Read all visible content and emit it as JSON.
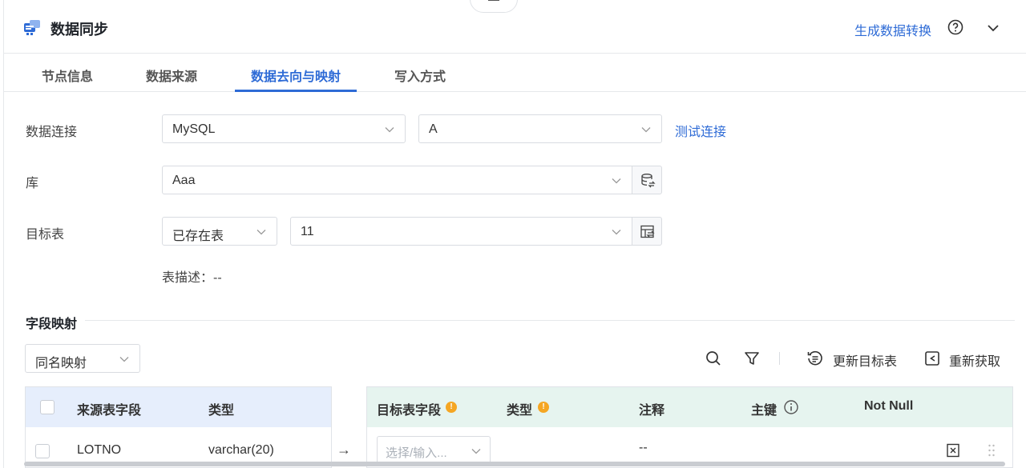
{
  "header": {
    "title": "数据同步",
    "generate_link": "生成数据转换"
  },
  "tabs": [
    {
      "label": "节点信息"
    },
    {
      "label": "数据来源"
    },
    {
      "label": "数据去向与映射",
      "active": true
    },
    {
      "label": "写入方式"
    }
  ],
  "form": {
    "connection_label": "数据连接",
    "connection_type": "MySQL",
    "connection_name": "A",
    "test_link": "测试连接",
    "db_label": "库",
    "db_value": "Aaa",
    "target_label": "目标表",
    "target_mode": "已存在表",
    "target_table": "11",
    "table_desc": "表描述：--"
  },
  "mapping": {
    "section_title": "字段映射",
    "mode": "同名映射",
    "update_target": "更新目标表",
    "refetch": "重新获取",
    "source_headers": [
      "来源表字段",
      "类型"
    ],
    "target_headers": [
      "目标表字段",
      "类型",
      "注释",
      "主键",
      "Not Null"
    ],
    "rows": [
      {
        "source_field": "LOTNO",
        "source_type": "varchar(20)",
        "target_placeholder": "选择/输入...",
        "comment": "--"
      }
    ]
  },
  "colors": {
    "accent": "#2e6bd6",
    "warning": "#f5a623",
    "source_header_bg": "#e6eefc",
    "target_header_bg": "#e6f4ef"
  },
  "icons": [
    "sync-app-icon",
    "help-icon",
    "chevron-down-icon",
    "database-refresh-icon",
    "table-refresh-icon",
    "search-icon",
    "filter-icon",
    "update-target-icon",
    "refetch-icon",
    "delete-row-icon",
    "drag-handle-icon"
  ]
}
